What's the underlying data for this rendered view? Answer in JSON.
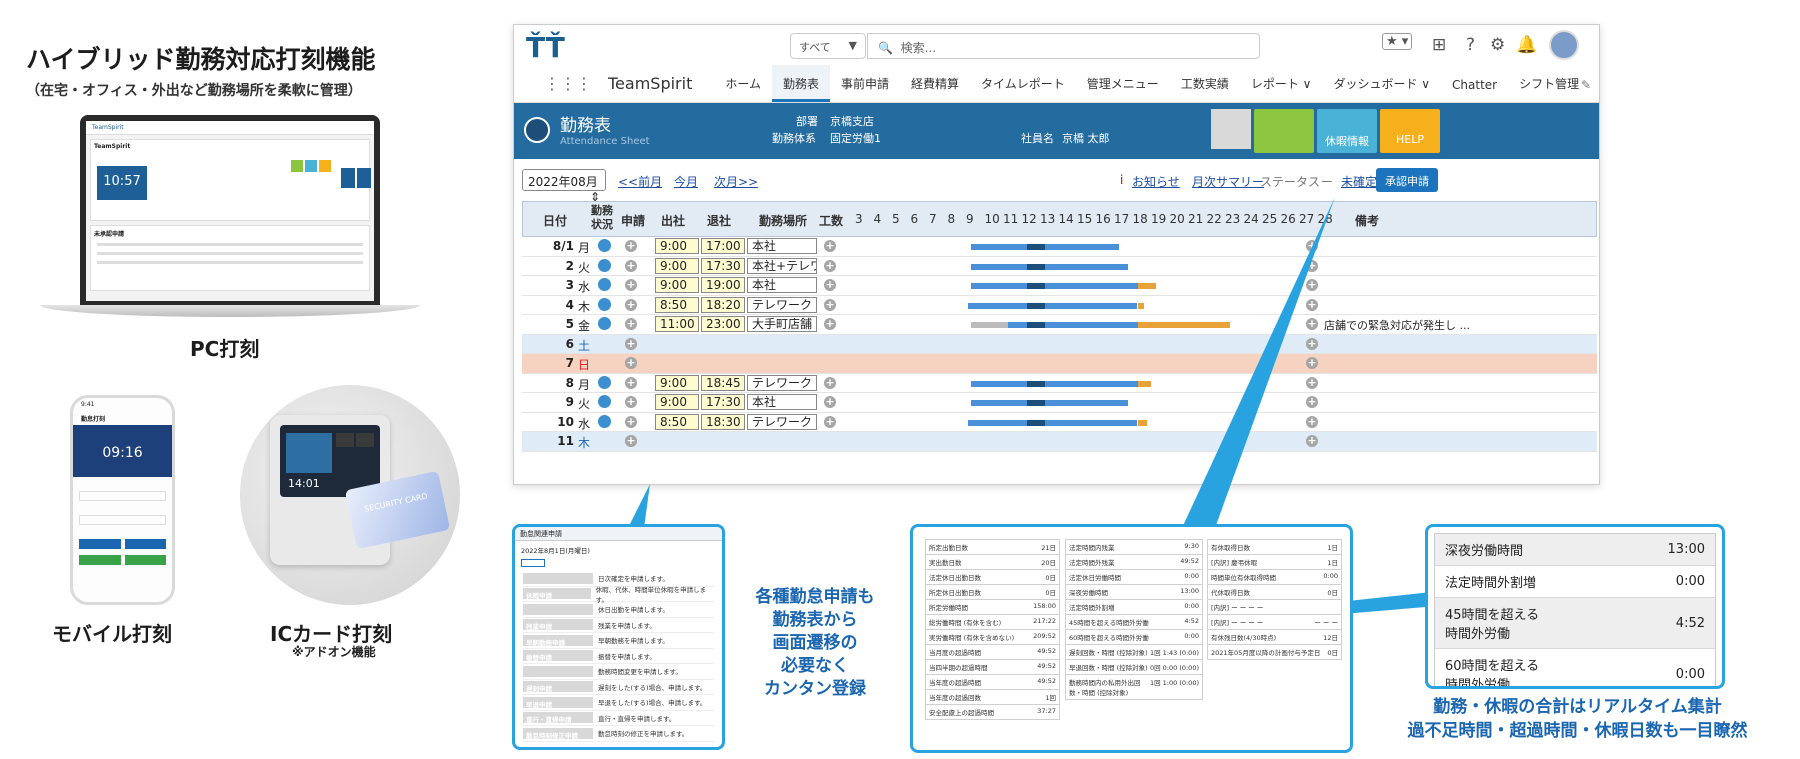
{
  "headline": "ハイブリッド勤務対応打刻機能",
  "subheadline": "（在宅・オフィス・外出など勤務場所を柔軟に管理）",
  "pc_label": "PC打刻",
  "mobile_label": "モバイル打刻",
  "ic_label": "ICカード打刻",
  "ic_note": "※アドオン機能",
  "mobile_mock": {
    "title": "勤怠打刻",
    "time": "09:16"
  },
  "ic_mock": {
    "time": "14:01",
    "card": "SECURITY CARD"
  },
  "laptop_mock": {
    "brand": "TeamSpirit",
    "time": "10:57",
    "section1": "TeamSpirit",
    "section2": "未承認申請"
  },
  "app": {
    "search_scope": "すべて",
    "search_placeholder": "検索...",
    "brand": "TeamSpirit",
    "nav": [
      "ホーム",
      "勤務表",
      "事前申請",
      "経費精算",
      "タイムレポート",
      "管理メニュー",
      "工数実績",
      "レポート ∨",
      "ダッシュボード ∨",
      "Chatter",
      "シフト管理"
    ],
    "active_nav": "勤務表",
    "page_title": "勤務表",
    "page_subtitle": "Attendance Sheet",
    "dept_label": "部署",
    "dept_value": "京橋支店",
    "system_label": "勤務体系",
    "system_value": "固定労働1",
    "employee_label": "社員名",
    "employee_value": "京橋 太郎",
    "leave_info": "休暇情報",
    "help": "HELP",
    "month": "2022年08月",
    "prev_month": "<<前月",
    "this_month": "今月",
    "next_month": "次月>>",
    "notice": "お知らせ",
    "monthly_summary": "月次サマリー",
    "status_label": "ステータス",
    "status_dash": "ー",
    "status_value": "未確定",
    "approve_button": "承認申請",
    "columns": {
      "date": "日付",
      "work_status": "勤務状況",
      "request": "申請",
      "in": "出社",
      "out": "退社",
      "place": "勤務場所",
      "manhours": "工数",
      "remarks": "備考"
    },
    "hours": [
      "3",
      "4",
      "5",
      "6",
      "7",
      "8",
      "9",
      "10",
      "11",
      "12",
      "13",
      "14",
      "15",
      "16",
      "17",
      "18",
      "19",
      "20",
      "21",
      "22",
      "23",
      "24",
      "25",
      "26",
      "27",
      "28"
    ],
    "rows": [
      {
        "d": "8/1",
        "w": "月",
        "in": "9:00",
        "out": "17:00",
        "place": "本社",
        "type": "work",
        "remark": ""
      },
      {
        "d": "2",
        "w": "火",
        "in": "9:00",
        "out": "17:30",
        "place": "本社+テレワー",
        "type": "work",
        "remark": ""
      },
      {
        "d": "3",
        "w": "水",
        "in": "9:00",
        "out": "19:00",
        "place": "本社",
        "type": "work",
        "remark": ""
      },
      {
        "d": "4",
        "w": "木",
        "in": "8:50",
        "out": "18:20",
        "place": "テレワーク",
        "type": "work",
        "remark": ""
      },
      {
        "d": "5",
        "w": "金",
        "in": "11:00",
        "out": "23:00",
        "place": "大手町店舗",
        "type": "work",
        "remark": "店舗での緊急対応が発生し ..."
      },
      {
        "d": "6",
        "w": "土",
        "in": "",
        "out": "",
        "place": "",
        "type": "sat",
        "remark": ""
      },
      {
        "d": "7",
        "w": "日",
        "in": "",
        "out": "",
        "place": "",
        "type": "sun",
        "remark": ""
      },
      {
        "d": "8",
        "w": "月",
        "in": "9:00",
        "out": "18:45",
        "place": "テレワーク",
        "type": "work",
        "remark": ""
      },
      {
        "d": "9",
        "w": "火",
        "in": "9:00",
        "out": "17:30",
        "place": "本社",
        "type": "work",
        "remark": ""
      },
      {
        "d": "10",
        "w": "水",
        "in": "8:50",
        "out": "18:30",
        "place": "テレワーク",
        "type": "work",
        "remark": ""
      },
      {
        "d": "11",
        "w": "木",
        "in": "",
        "out": "",
        "place": "",
        "type": "sat",
        "remark": ""
      }
    ]
  },
  "request_panel": {
    "title": "勤怠関連申請",
    "date": "2022年8月1日(月曜日)",
    "items": [
      [
        "",
        "日次確定を申請します。"
      ],
      [
        "休暇申請",
        "休暇、代休、時間単位休暇を申請します。"
      ],
      [
        "",
        "休日出勤を申請します。"
      ],
      [
        "残業申請",
        "残業を申請します。"
      ],
      [
        "早朝勤務申請",
        "早朝勤務を申請します。"
      ],
      [
        "振替申請",
        "振替を申請します。"
      ],
      [
        "",
        "勤務時間変更を申請します。"
      ],
      [
        "遅刻申請",
        "遅刻をした(する)場合、申請します。"
      ],
      [
        "早退申請",
        "早退をした(する)場合、申請します。"
      ],
      [
        "直行・直帰申請",
        "直行・直帰を申請します。"
      ],
      [
        "勤怠時刻修正申請",
        "勤怠時刻の修正を申請します。"
      ]
    ]
  },
  "caption_middle": [
    "各種勤怠申請も",
    "勤務表から",
    "画面遷移の",
    "必要なく",
    "カンタン登録"
  ],
  "monthly_panel": {
    "col1": [
      [
        "所定出勤日数",
        "21日"
      ],
      [
        "実出勤日数",
        "20日"
      ],
      [
        "法定休日出勤日数",
        "0日"
      ],
      [
        "所定休日出勤日数",
        "0日"
      ],
      [
        "所定労働時間",
        "158:00"
      ],
      [
        "総労働時間 (有休を含む)",
        "217:22"
      ],
      [
        "実労働時間 (有休を含めない)",
        "209:52"
      ],
      [
        "当月度の超過時間",
        "49:52"
      ],
      [
        "当四半期の超過時間",
        "49:52"
      ],
      [
        "当年度の超過時間",
        "49:52"
      ],
      [
        "当年度の超過回数",
        "1回"
      ],
      [
        "安全配慮上の超過時間",
        "37:27"
      ]
    ],
    "col2": [
      [
        "法定時間内残業",
        "9:30"
      ],
      [
        "法定時間外残業",
        "49:52"
      ],
      [
        "法定休日労働時間",
        "0:00"
      ],
      [
        "深夜労働時間",
        "13:00"
      ],
      [
        "法定時間外割増",
        "0:00"
      ],
      [
        "45時間を超える時間外労働",
        "4:52"
      ],
      [
        "60時間を超える時間外労働",
        "0:00"
      ],
      [
        "遅刻回数・時間 (控除対象)",
        "1回 1:43 (0:00)"
      ],
      [
        "早退回数・時間 (控除対象)",
        "0回 0:00 (0:00)"
      ],
      [
        "勤務時間内の私用外出回数・時間 (控除対象)",
        "1回 1:00 (0:00)"
      ]
    ],
    "col3": [
      [
        "有休取得日数",
        "1日"
      ],
      [
        "[内訳] 慶弔休暇",
        "1日"
      ],
      [
        "時間単位有休取得時間",
        "0:00"
      ],
      [
        "代休取得日数",
        "0日"
      ],
      [
        "[内訳] ー ー ー ー",
        ""
      ],
      [
        "[内訳] ー ー ー ー",
        "ー ー ー"
      ],
      [
        "有休残日数(4/30時点)",
        "12日"
      ],
      [
        "2021年05月度以降の計画付与予定日",
        "0日"
      ]
    ]
  },
  "summary_popup": [
    [
      "深夜労働時間",
      "13:00"
    ],
    [
      "法定時間外割増",
      "0:00"
    ],
    [
      "45時間を超える\n時間外労働",
      "4:52"
    ],
    [
      "60時間を超える\n時間外労働",
      "0:00"
    ]
  ],
  "caption_right": [
    "勤務・休暇の合計はリアルタイム集計",
    "過不足時間・超過時間・休暇日数も一目瞭然"
  ],
  "colors": {
    "accent": "#1a75bb",
    "band": "#246ba0",
    "green": "#8cc63f",
    "teal": "#4ab2d6",
    "orange": "#f6b01c",
    "panel_border": "#29a3e0",
    "bar_blue": "#4a90d8",
    "bar_orange": "#e8a23a"
  }
}
